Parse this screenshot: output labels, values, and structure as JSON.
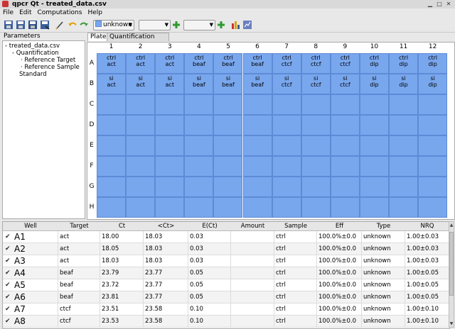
{
  "window": {
    "title": "qpcr Qt - treated_data.csv"
  },
  "menu": [
    "File",
    "Edit",
    "Computations",
    "Help"
  ],
  "toolbar": {
    "type_combo": "unknown",
    "color_accent": "#79a7ee"
  },
  "left_panel": {
    "header": "Parameters",
    "tree": [
      "treated_data.csv",
      "Quantification",
      "Reference Target",
      "Reference Sample",
      "Standard"
    ]
  },
  "tabs": [
    "Plate",
    "Quantification"
  ],
  "plate": {
    "columns": [
      "1",
      "2",
      "3",
      "4",
      "5",
      "6",
      "7",
      "8",
      "9",
      "10",
      "11",
      "12"
    ],
    "rows": [
      "A",
      "B",
      "C",
      "D",
      "E",
      "F",
      "G",
      "H"
    ],
    "rowA": [
      [
        "ctrl",
        "act"
      ],
      [
        "ctrl",
        "act"
      ],
      [
        "ctrl",
        "act"
      ],
      [
        "ctrl",
        "beaf"
      ],
      [
        "ctrl",
        "beaf"
      ],
      [
        "ctrl",
        "beaf"
      ],
      [
        "ctrl",
        "ctcf"
      ],
      [
        "ctrl",
        "ctcf"
      ],
      [
        "ctrl",
        "ctcf"
      ],
      [
        "ctrl",
        "dip"
      ],
      [
        "ctrl",
        "dip"
      ],
      [
        "ctrl",
        "dip"
      ]
    ],
    "rowB": [
      [
        "si",
        "act"
      ],
      [
        "si",
        "act"
      ],
      [
        "si",
        "act"
      ],
      [
        "si",
        "beaf"
      ],
      [
        "si",
        "beaf"
      ],
      [
        "si",
        "beaf"
      ],
      [
        "si",
        "ctcf"
      ],
      [
        "si",
        "ctcf"
      ],
      [
        "si",
        "ctcf"
      ],
      [
        "si",
        "dip"
      ],
      [
        "si",
        "dip"
      ],
      [
        "si",
        "dip"
      ]
    ]
  },
  "table": {
    "headers": [
      "Well",
      "Target",
      "Ct",
      "<Ct>",
      "E(Ct)",
      "Amount",
      "Sample",
      "Eff",
      "Type",
      "NRQ"
    ],
    "rows": [
      [
        "A1",
        "act",
        "18.00",
        "18.03",
        "0.03",
        "",
        "ctrl",
        "100.0%±0.0",
        "unknown",
        "1.00±0.03"
      ],
      [
        "A2",
        "act",
        "18.05",
        "18.03",
        "0.03",
        "",
        "ctrl",
        "100.0%±0.0",
        "unknown",
        "1.00±0.03"
      ],
      [
        "A3",
        "act",
        "18.03",
        "18.03",
        "0.03",
        "",
        "ctrl",
        "100.0%±0.0",
        "unknown",
        "1.00±0.03"
      ],
      [
        "A4",
        "beaf",
        "23.79",
        "23.77",
        "0.05",
        "",
        "ctrl",
        "100.0%±0.0",
        "unknown",
        "1.00±0.05"
      ],
      [
        "A5",
        "beaf",
        "23.72",
        "23.77",
        "0.05",
        "",
        "ctrl",
        "100.0%±0.0",
        "unknown",
        "1.00±0.05"
      ],
      [
        "A6",
        "beaf",
        "23.81",
        "23.77",
        "0.05",
        "",
        "ctrl",
        "100.0%±0.0",
        "unknown",
        "1.00±0.05"
      ],
      [
        "A7",
        "ctcf",
        "23.51",
        "23.58",
        "0.10",
        "",
        "ctrl",
        "100.0%±0.0",
        "unknown",
        "1.00±0.10"
      ],
      [
        "A8",
        "ctcf",
        "23.53",
        "23.58",
        "0.10",
        "",
        "ctrl",
        "100.0%±0.0",
        "unknown",
        "1.00±0.10"
      ]
    ]
  }
}
